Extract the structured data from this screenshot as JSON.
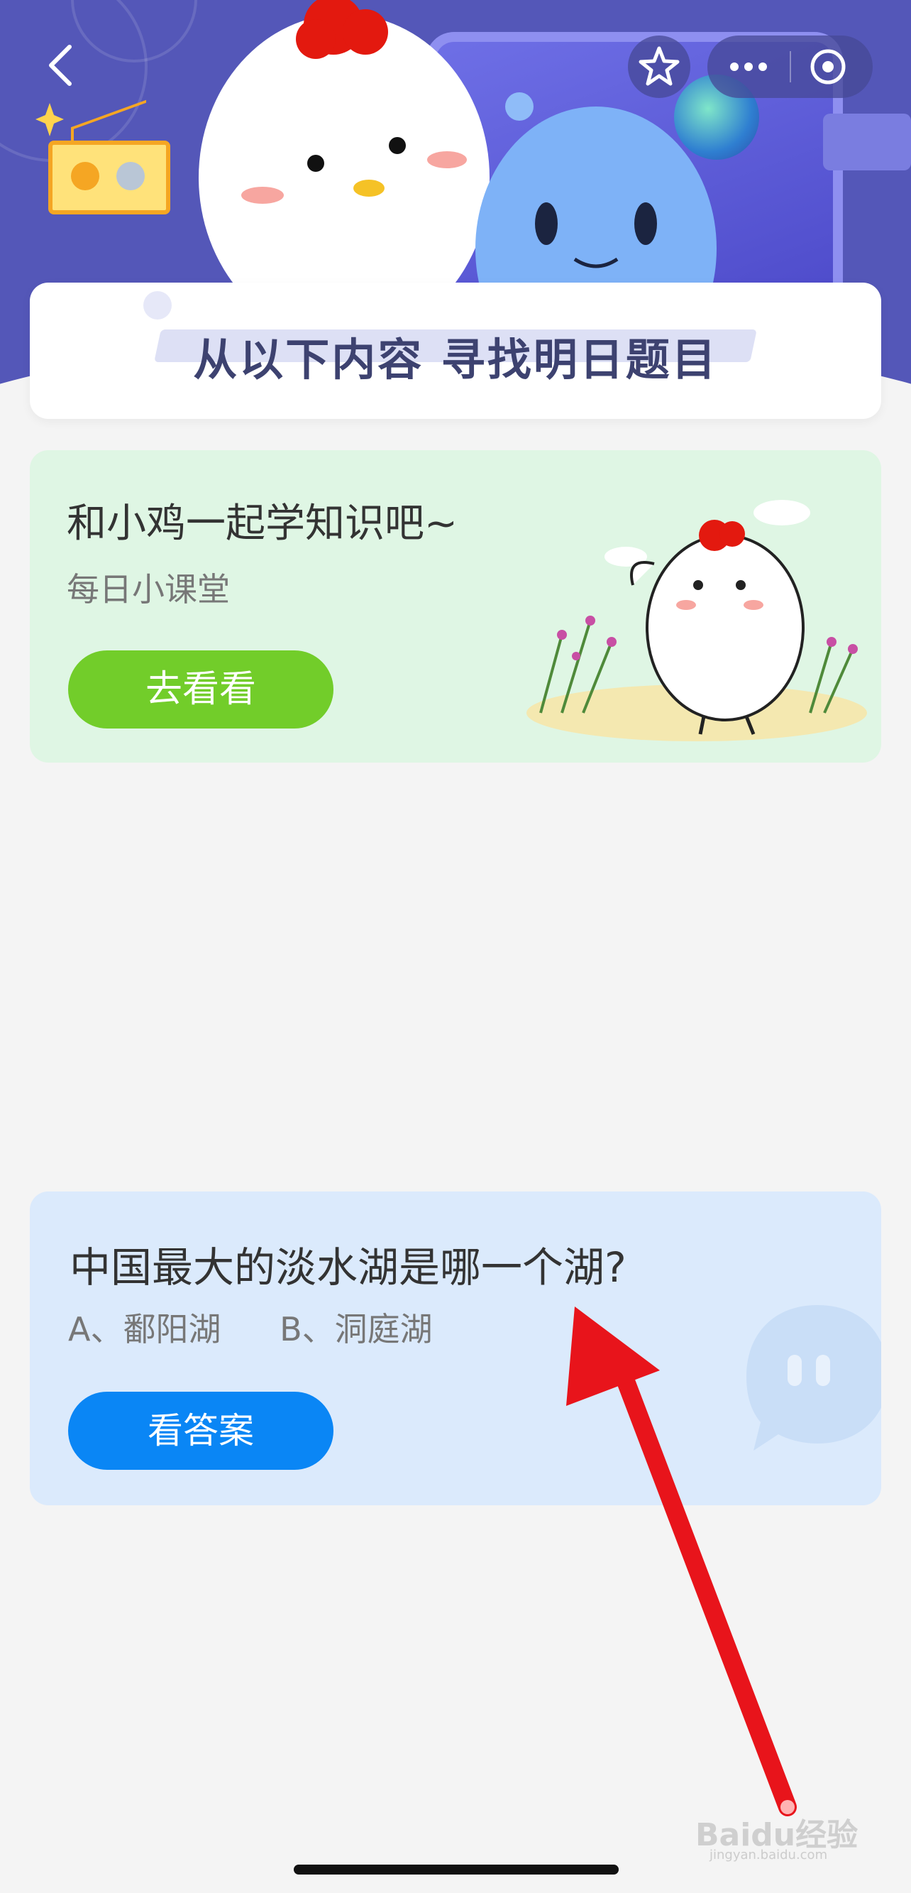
{
  "header": {
    "banner_title": "从以下内容  寻找明日题目",
    "capsule": {
      "favorite_icon": "star-icon",
      "more_icon": "more-dots-icon",
      "close_icon": "target-circle-icon"
    }
  },
  "lesson_card": {
    "title": "和小鸡一起学知识吧~",
    "subtitle": "每日小课堂",
    "button_label": "去看看"
  },
  "quiz_card": {
    "question": "中国最大的淡水湖是哪一个湖?",
    "options": [
      "A、鄱阳湖",
      "B、洞庭湖"
    ],
    "button_label": "看答案"
  },
  "watermark": {
    "text": "Baidu经验",
    "sub": "jingyan.baidu.com"
  },
  "colors": {
    "header_bg": "#5457b8",
    "green_card_bg": "#dff6e4",
    "green_button": "#72cd2a",
    "blue_card_bg": "#dbeafc",
    "blue_button": "#0a86f5",
    "arrow": "#e8141b"
  }
}
